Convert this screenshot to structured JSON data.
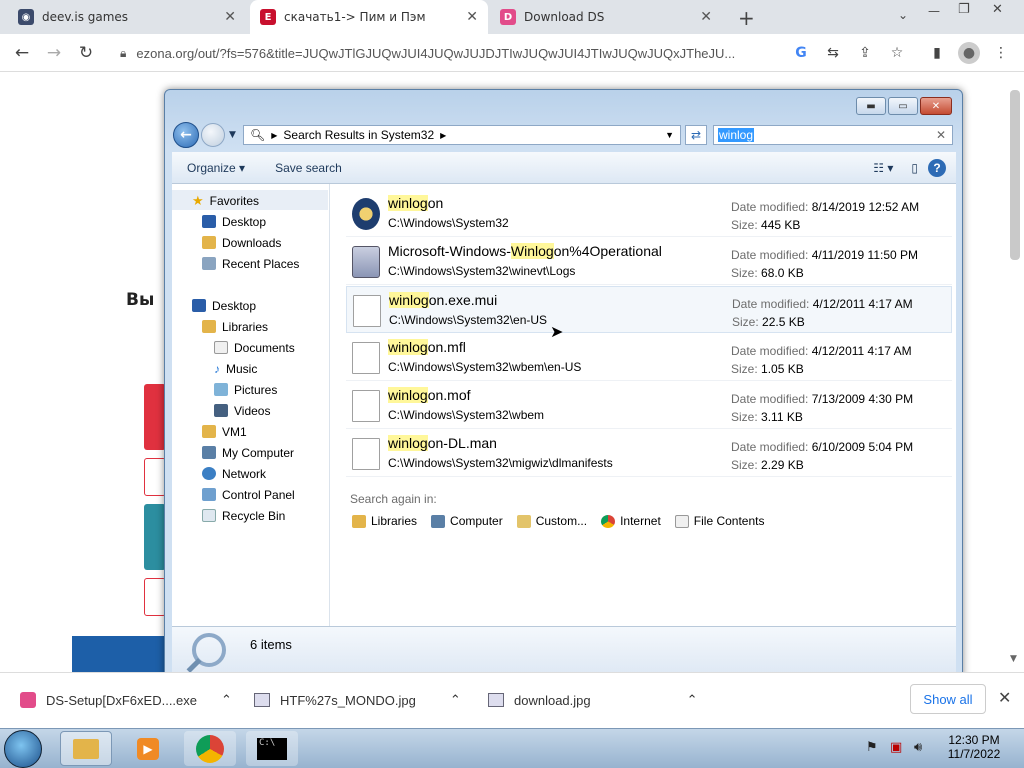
{
  "browser": {
    "tabs": [
      {
        "title": "deev.is games",
        "icon": "deev-favicon"
      },
      {
        "title": "скачать1-> Пим и Пэм",
        "icon": "ezona-favicon"
      },
      {
        "title": "Download DS",
        "icon": "ds-favicon"
      }
    ],
    "url": "ezona.org/out/?fs=576&title=JUQwJTlGJUQwJUI4JUQwJUJDJTIwJUQwJUI4JTIwJUQwJUQxJTheJU..."
  },
  "page_underlay": {
    "heading_fragment": "Вы"
  },
  "explorer": {
    "breadcrumb": "Search Results in System32",
    "search_query": "winlog",
    "commands": {
      "organize": "Organize",
      "save_search": "Save search"
    },
    "nav": {
      "favorites": "Favorites",
      "fav_items": [
        "Desktop",
        "Downloads",
        "Recent Places"
      ],
      "desktop": "Desktop",
      "libraries": "Libraries",
      "lib_items": [
        "Documents",
        "Music",
        "Pictures",
        "Videos"
      ],
      "other_items": [
        "VM1",
        "My Computer",
        "Network",
        "Control Panel",
        "Recycle Bin"
      ]
    },
    "results": [
      {
        "match": "winlog",
        "name_rest": "on",
        "name_prefix": "",
        "path": "C:\\Windows\\System32",
        "date_label": "Date modified:",
        "date": "8/14/2019 12:52 AM",
        "size_label": "Size:",
        "size": "445 KB",
        "icon": "winlogon-app-icon"
      },
      {
        "match": "Winlog",
        "name_rest": "on%4Operational",
        "name_prefix": "Microsoft-Windows-",
        "path": "C:\\Windows\\System32\\winevt\\Logs",
        "date_label": "Date modified:",
        "date": "4/11/2019 11:50 PM",
        "size_label": "Size:",
        "size": "68.0 KB",
        "icon": "event-log-icon"
      },
      {
        "match": "winlog",
        "name_rest": "on.exe.mui",
        "name_prefix": "",
        "path": "C:\\Windows\\System32\\en-US",
        "date_label": "Date modified:",
        "date": "4/12/2011 4:17 AM",
        "size_label": "Size:",
        "size": "22.5 KB",
        "icon": "file-icon"
      },
      {
        "match": "winlog",
        "name_rest": "on.mfl",
        "name_prefix": "",
        "path": "C:\\Windows\\System32\\wbem\\en-US",
        "date_label": "Date modified:",
        "date": "4/12/2011 4:17 AM",
        "size_label": "Size:",
        "size": "1.05 KB",
        "icon": "file-icon"
      },
      {
        "match": "winlog",
        "name_rest": "on.mof",
        "name_prefix": "",
        "path": "C:\\Windows\\System32\\wbem",
        "date_label": "Date modified:",
        "date": "7/13/2009 4:30 PM",
        "size_label": "Size:",
        "size": "3.11 KB",
        "icon": "file-icon"
      },
      {
        "match": "winlog",
        "name_rest": "on-DL.man",
        "name_prefix": "",
        "path": "C:\\Windows\\System32\\migwiz\\dlmanifests",
        "date_label": "Date modified:",
        "date": "6/10/2009 5:04 PM",
        "size_label": "Size:",
        "size": "2.29 KB",
        "icon": "file-icon"
      }
    ],
    "search_again_label": "Search again in:",
    "search_again": [
      "Libraries",
      "Computer",
      "Custom...",
      "Internet",
      "File Contents"
    ],
    "item_count": "6 items"
  },
  "downloads": [
    {
      "name": "DS-Setup[DxF6xED....exe"
    },
    {
      "name": "HTF%27s_MONDO.jpg"
    },
    {
      "name": "download.jpg"
    }
  ],
  "downloads_show_all": "Show all",
  "clock": {
    "time": "12:30 PM",
    "date": "11/7/2022"
  }
}
